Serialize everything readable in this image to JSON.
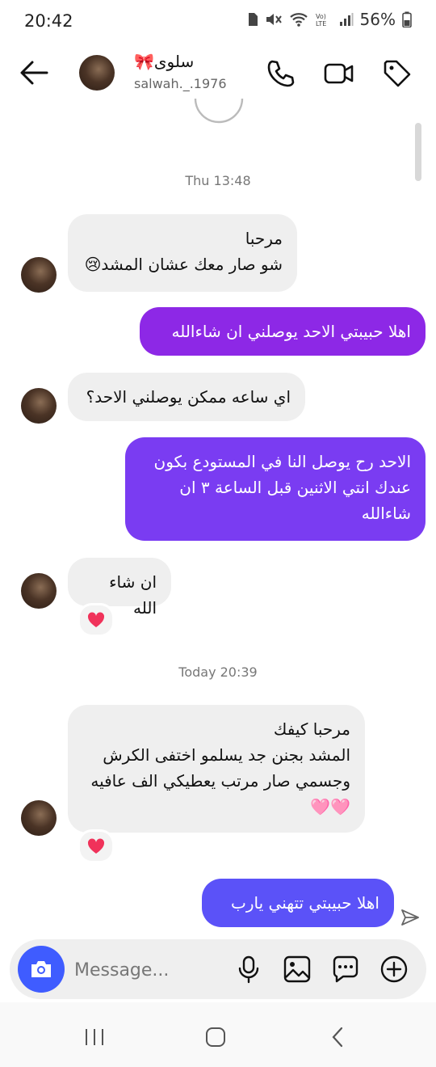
{
  "status_bar": {
    "time": "20:42",
    "battery": "56%"
  },
  "header": {
    "display_name": "🎀سلوى",
    "username": "salwah._.1976"
  },
  "thread": {
    "stamp_1": "Thu 13:48",
    "msg_1": "مرحبا\nشو صار معك عشان المشد😢",
    "msg_2": "اهلا حبيبتي الاحد يوصلني ان شاءالله",
    "msg_3": "اي ساعه ممكن يوصلني الاحد؟",
    "msg_4": "الاحد رح يوصل النا في المستودع بكون عندك انتي الاثنين قبل الساعة ٣ ان شاءالله",
    "msg_5": "ان شاء الله",
    "stamp_2": "Today 20:39",
    "msg_6": "مرحبا كيفك\nالمشد بجنن جد يسلمو اختفى الكرش وجسمي صار مرتب يعطيكي الف عافيه\n🩷🩷",
    "msg_7": "اهلا حبيبتي تتهني يارب"
  },
  "composer": {
    "placeholder": "Message..."
  },
  "colors": {
    "purple_out": "#8d28e6",
    "violet_out": "#7a3cf2",
    "blue_out": "#5b52f8",
    "accent_blue": "#3f5cff",
    "heart": "#f0325a"
  }
}
